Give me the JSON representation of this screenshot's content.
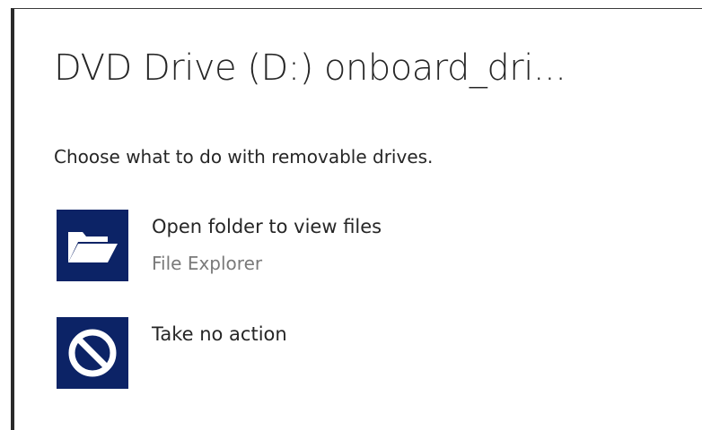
{
  "dialog": {
    "title": "DVD Drive (D:) onboard_dri...",
    "prompt": "Choose what to do with removable drives.",
    "options": [
      {
        "label": "Open folder to view files",
        "sublabel": "File Explorer",
        "icon": "folder-open-icon"
      },
      {
        "label": "Take no action",
        "icon": "no-action-icon"
      }
    ]
  },
  "colors": {
    "tile_background": "#0c2366",
    "tile_icon": "#ffffff",
    "text_primary": "#262626",
    "text_secondary": "#7a7a7a"
  }
}
